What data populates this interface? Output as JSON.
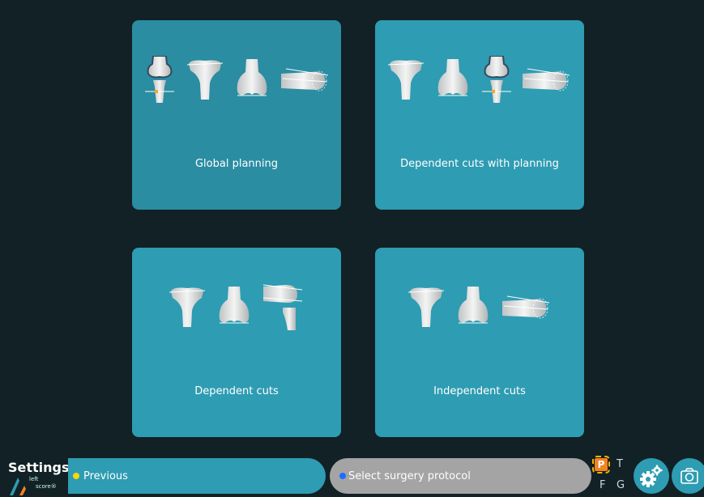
{
  "cards": [
    {
      "label": "Global planning"
    },
    {
      "label": "Dependent cuts with planning"
    },
    {
      "label": "Dependent cuts"
    },
    {
      "label": "Independent cuts"
    }
  ],
  "bottom": {
    "settings_title": "Settings",
    "logo_line1": "left",
    "logo_line2": "score®",
    "previous_label": "Previous",
    "protocol_label": "Select surgery protocol",
    "indicators": {
      "p": "P",
      "t": "T",
      "f": "F",
      "g": "G"
    }
  },
  "colors": {
    "background": "#112125",
    "card": "#2e9cb2",
    "card_selected": "#2a8da2",
    "previous_dot": "#f5d90a",
    "protocol_dot": "#1f6bff",
    "protocol_bg": "#a4a4a4",
    "p_badge": "#f58220"
  },
  "icons": [
    "knee-joint-icon",
    "tibia-icon",
    "femur-icon",
    "femur-side-icon",
    "gear-icon",
    "camera-icon"
  ]
}
